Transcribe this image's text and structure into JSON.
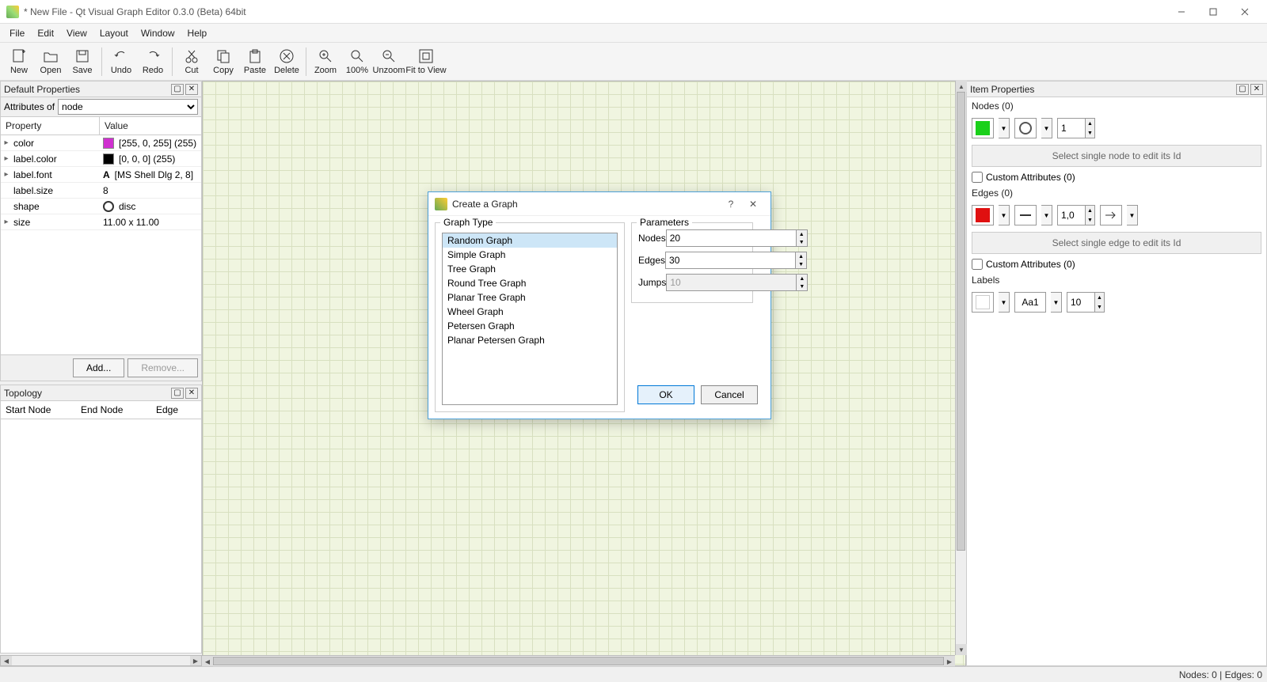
{
  "window": {
    "title": "* New File - Qt Visual Graph Editor 0.3.0 (Beta) 64bit"
  },
  "menu": [
    "File",
    "Edit",
    "View",
    "Layout",
    "Window",
    "Help"
  ],
  "toolbar": [
    {
      "id": "new",
      "label": "New"
    },
    {
      "id": "open",
      "label": "Open"
    },
    {
      "id": "save",
      "label": "Save"
    },
    {
      "sep": true
    },
    {
      "id": "undo",
      "label": "Undo"
    },
    {
      "id": "redo",
      "label": "Redo"
    },
    {
      "sep": true
    },
    {
      "id": "cut",
      "label": "Cut"
    },
    {
      "id": "copy",
      "label": "Copy"
    },
    {
      "id": "paste",
      "label": "Paste"
    },
    {
      "id": "delete",
      "label": "Delete"
    },
    {
      "sep": true
    },
    {
      "id": "zoom",
      "label": "Zoom"
    },
    {
      "id": "100",
      "label": "100%"
    },
    {
      "id": "unzoom",
      "label": "Unzoom"
    },
    {
      "id": "fit",
      "label": "Fit to View",
      "wide": true
    }
  ],
  "defaultProperties": {
    "title": "Default Properties",
    "attributesOfLabel": "Attributes of",
    "attributesOfValue": "node",
    "headProperty": "Property",
    "headValue": "Value",
    "rows": [
      {
        "name": "color",
        "value": "[255, 0, 255] (255)",
        "swatch": "#d030d0"
      },
      {
        "name": "label.color",
        "value": "[0, 0, 0] (255)",
        "swatch": "#000000"
      },
      {
        "name": "label.font",
        "value": "[MS Shell Dlg 2, 8]",
        "glyph": "A"
      },
      {
        "name": "label.size",
        "value": "8"
      },
      {
        "name": "shape",
        "value": "disc",
        "shape": "circle"
      },
      {
        "name": "size",
        "value": "11.00 x 11.00"
      }
    ],
    "addLabel": "Add...",
    "removeLabel": "Remove..."
  },
  "topology": {
    "title": "Topology",
    "cols": [
      "Start Node",
      "End Node",
      "Edge"
    ]
  },
  "itemProperties": {
    "title": "Item Properties",
    "nodesTitle": "Nodes (0)",
    "nodeColor": "#1ad01a",
    "nodeWeight": "1",
    "nodeHint": "Select single node to edit its Id",
    "nodeCustom": "Custom Attributes (0)",
    "edgesTitle": "Edges (0)",
    "edgeColor": "#e01010",
    "edgeWeight": "1,0",
    "edgeHint": "Select single edge to edit its Id",
    "edgeCustom": "Custom Attributes (0)",
    "labelsTitle": "Labels",
    "labelColor": "#ffffff",
    "labelFont": "Aa1",
    "labelSize": "10"
  },
  "dialog": {
    "title": "Create a Graph",
    "graphTypeLabel": "Graph Type",
    "graphTypes": [
      "Random Graph",
      "Simple Graph",
      "Tree Graph",
      "Round Tree Graph",
      "Planar Tree Graph",
      "Wheel Graph",
      "Petersen Graph",
      "Planar Petersen Graph"
    ],
    "selectedIndex": 0,
    "parametersLabel": "Parameters",
    "params": {
      "nodesLabel": "Nodes",
      "nodesValue": "20",
      "edgesLabel": "Edges",
      "edgesValue": "30",
      "jumpsLabel": "Jumps",
      "jumpsValue": "10",
      "jumpsDisabled": true
    },
    "okLabel": "OK",
    "cancelLabel": "Cancel"
  },
  "statusbar": "Nodes: 0 | Edges: 0"
}
